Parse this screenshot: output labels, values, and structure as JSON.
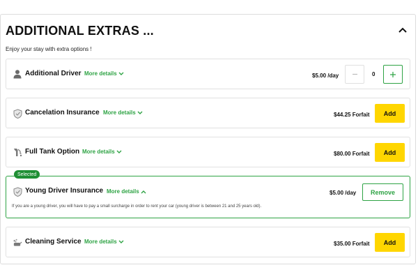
{
  "header": {
    "title": "ADDITIONAL EXTRAS ...",
    "subtitle": "Enjoy your stay with extra options !",
    "collapse_icon": "chevron-up-icon"
  },
  "extras": [
    {
      "name": "Additional Driver",
      "more_label": "More details",
      "price": "$5.00 /day",
      "control": "stepper",
      "quantity": "0",
      "icon": "person-icon"
    },
    {
      "name": "Cancelation Insurance",
      "more_label": "More details",
      "price": "$44.25 Forfait",
      "control": "add",
      "button_label": "Add",
      "icon": "shield-icon"
    },
    {
      "name": "Full Tank Option",
      "more_label": "More details",
      "price": "$80.00 Forfait",
      "control": "add",
      "button_label": "Add",
      "icon": "fuel-pump-icon"
    },
    {
      "name": "Young Driver Insurance",
      "more_label": "More details",
      "price": "$5.00 /day",
      "control": "remove",
      "button_label": "Remove",
      "badge": "Selected",
      "description": "If you are a young driver, you will have to pay a small surcharge in order to rent your car (young driver is between 21 and 25 years old).",
      "icon": "shield-icon"
    },
    {
      "name": "Cleaning Service",
      "more_label": "More details",
      "price": "$35.00 Forfait",
      "control": "add",
      "button_label": "Add",
      "icon": "cleaning-icon"
    }
  ],
  "colors": {
    "accent_green": "#2ea344",
    "add_yellow": "#ffd600"
  }
}
